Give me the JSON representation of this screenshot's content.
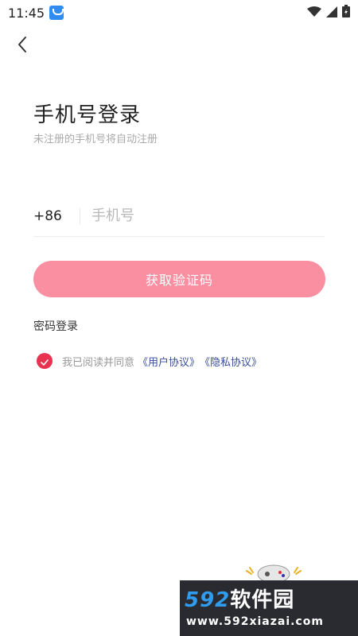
{
  "status_bar": {
    "time": "11:45",
    "icons": [
      "app-notification-icon",
      "wifi-icon",
      "signal-icon",
      "battery-icon"
    ]
  },
  "header": {
    "back_icon": "chevron-left-icon"
  },
  "login": {
    "title": "手机号登录",
    "subtitle": "未注册的手机号将自动注册",
    "country_code": "+86",
    "phone_placeholder": "手机号",
    "phone_value": "",
    "get_code_label": "获取验证码",
    "password_login_label": "密码登录"
  },
  "agreement": {
    "checked": true,
    "prefix": "我已阅读并同意",
    "user_agreement": "《用户协议》",
    "privacy_policy": "《隐私协议》"
  },
  "watermark": {
    "brand_num": "592",
    "brand_cn": "软件园",
    "url": "www.592xiazai.com"
  },
  "colors": {
    "primary_button": "#f98fa1",
    "checkbox": "#e8324f",
    "link": "#3a4f9a",
    "watermark_bg": "#2a2b30",
    "watermark_accent": "#2f9cf0"
  }
}
